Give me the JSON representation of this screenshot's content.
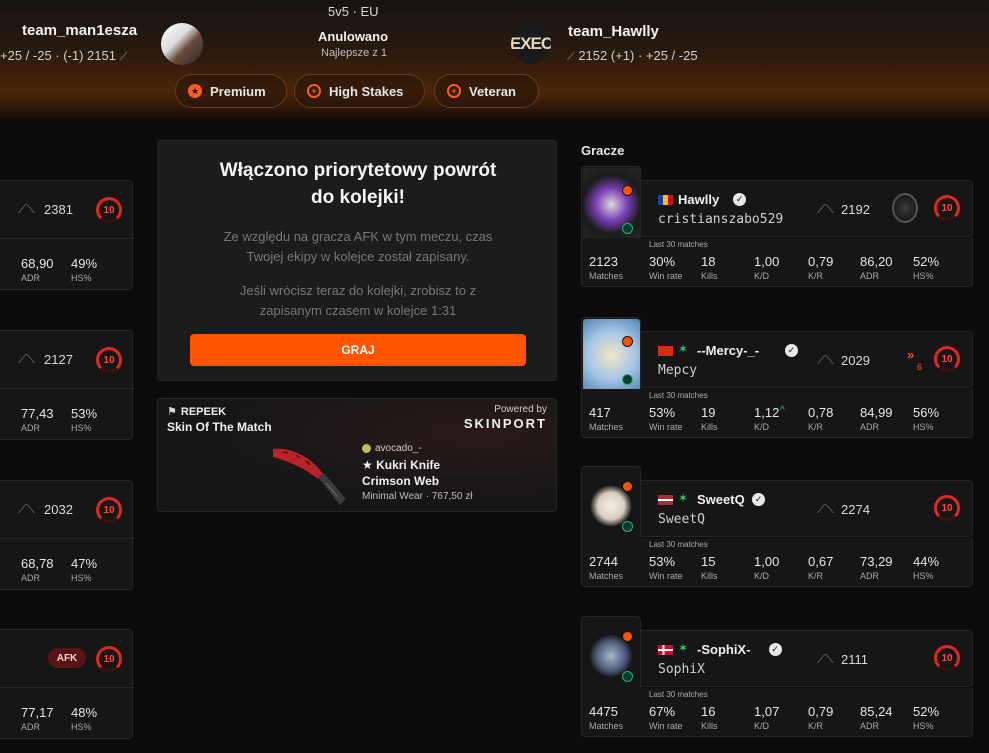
{
  "header": {
    "mode": "5v5 · EU",
    "status": "Anulowano",
    "format": "Najlepsze z 1",
    "team1": {
      "name": "team_man1esza",
      "stats": "+25 / -25  ·  (-1) 2151"
    },
    "team2": {
      "name": "team_Hawlly",
      "stats": "2152 (+1)  ·  +25 / -25",
      "logo_text": "EXEC"
    },
    "pills": [
      {
        "label": "Premium",
        "icon": "star-icon"
      },
      {
        "label": "High Stakes",
        "icon": "crosshair-icon"
      },
      {
        "label": "Veteran",
        "icon": "crosshair-icon"
      }
    ]
  },
  "left_players": [
    {
      "elo": "2381",
      "level": "10",
      "adr": "68,90",
      "hs": "49%"
    },
    {
      "elo": "2127",
      "level": "10",
      "adr": "77,43",
      "hs": "53%"
    },
    {
      "elo": "2032",
      "level": "10",
      "adr": "68,78",
      "hs": "47%"
    },
    {
      "elo": "",
      "level": "10",
      "afk": "AFK",
      "adr": "77,17",
      "hs": "48%"
    }
  ],
  "labels": {
    "adr": "ADR",
    "hs": "HS%",
    "matches": "Matches",
    "winrate": "Win rate",
    "kills": "Kills",
    "kd": "K/D",
    "kr": "K/R",
    "last30": "Last 30 matches",
    "players": "Gracze"
  },
  "priority": {
    "title_line1": "Włączono priorytetowy powrót",
    "title_line2": "do kolejki!",
    "text1_line1": "Ze względu na gracza AFK w tym meczu, czas",
    "text1_line2": "Twojej ekipy w kolejce został zapisany.",
    "text2_line1": "Jeśli wrócisz teraz do kolejki, zrobisz to z",
    "text2_line2": "zapisanym czasem w kolejce 1:31",
    "button": "GRAJ"
  },
  "sotm": {
    "brand": "REPEEK",
    "title": "Skin Of The Match",
    "powered": "Powered by",
    "partner": "SKINPORT",
    "user": "avocado_-",
    "item_line1": "★ Kukri Knife",
    "item_line2": "Crimson Web",
    "condition": "Minimal Wear · 767,50 zł"
  },
  "right_players": [
    {
      "name": "Hawlly",
      "sub": "cristianszabo529",
      "elo": "2192",
      "level": "10",
      "flag": "ro",
      "matches": "2123",
      "winrate": "30%",
      "kills": "18",
      "kd": "1,00",
      "kr": "0,79",
      "adr": "86,20",
      "hs": "52%"
    },
    {
      "name": "--Mercy-_-",
      "sub": "Мерсу",
      "elo": "2029",
      "level": "10",
      "flag": "cn",
      "rank_down": "6",
      "matches": "417",
      "winrate": "53%",
      "kills": "19",
      "kd": "1,12",
      "kr": "0,78",
      "adr": "84,99",
      "hs": "56%"
    },
    {
      "name": "SweetQ",
      "sub": "SweetQ",
      "elo": "2274",
      "level": "10",
      "flag": "lv",
      "matches": "2744",
      "winrate": "53%",
      "kills": "15",
      "kd": "1,00",
      "kr": "0,67",
      "adr": "73,29",
      "hs": "44%"
    },
    {
      "name": "-SophiX-",
      "sub": "SophiX",
      "elo": "2111",
      "level": "10",
      "flag": "dk",
      "matches": "4475",
      "winrate": "67%",
      "kills": "16",
      "kd": "1,07",
      "kr": "0,79",
      "adr": "85,24",
      "hs": "52%"
    }
  ],
  "colors": {
    "accent": "#ff5500",
    "level": "#e0281e",
    "card": "#161616"
  }
}
